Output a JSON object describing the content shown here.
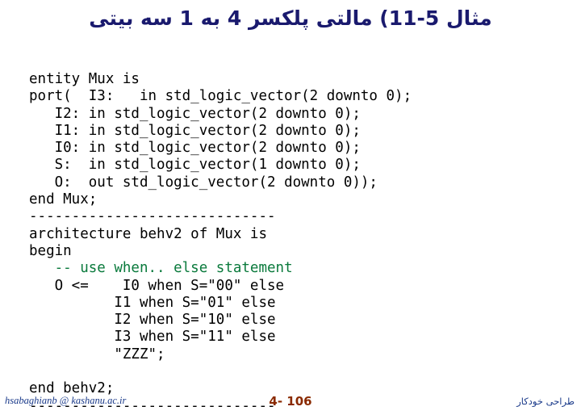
{
  "slide": {
    "title": "مثال 5-11) مالتی پلکسر 4 به 1 سه بیتی",
    "code_lines": [
      {
        "text": "entity Mux is",
        "comment": false
      },
      {
        "text": "port(  I3:   in std_logic_vector(2 downto 0);",
        "comment": false
      },
      {
        "text": "   I2: in std_logic_vector(2 downto 0);",
        "comment": false
      },
      {
        "text": "   I1: in std_logic_vector(2 downto 0);",
        "comment": false
      },
      {
        "text": "   I0: in std_logic_vector(2 downto 0);",
        "comment": false
      },
      {
        "text": "   S:  in std_logic_vector(1 downto 0);",
        "comment": false
      },
      {
        "text": "   O:  out std_logic_vector(2 downto 0));",
        "comment": false
      },
      {
        "text": "end Mux;",
        "comment": false
      },
      {
        "text": "-----------------------------",
        "comment": false
      },
      {
        "text": "architecture behv2 of Mux is",
        "comment": false
      },
      {
        "text": "begin",
        "comment": false
      },
      {
        "text": "   -- use when.. else statement",
        "comment": true
      },
      {
        "text": "   O <=    I0 when S=\"00\" else",
        "comment": false
      },
      {
        "text": "          I1 when S=\"01\" else",
        "comment": false
      },
      {
        "text": "          I2 when S=\"10\" else",
        "comment": false
      },
      {
        "text": "          I3 when S=\"11\" else",
        "comment": false
      },
      {
        "text": "          \"ZZZ\";",
        "comment": false
      },
      {
        "text": "",
        "comment": false
      },
      {
        "text": "end behv2;",
        "comment": false
      },
      {
        "text": "-----------------------------",
        "comment": false
      }
    ],
    "footer": {
      "left": "hsabaghianb @ kashanu.ac.ir",
      "center": "4- 106",
      "right": "طراحی خودکار"
    }
  }
}
